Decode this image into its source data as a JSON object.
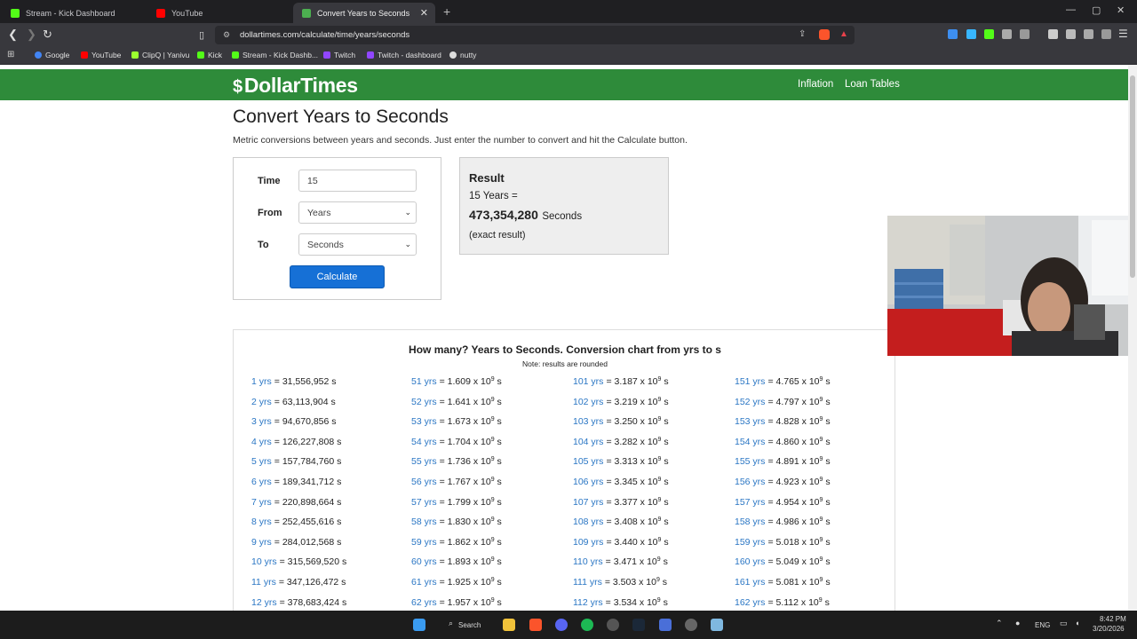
{
  "browser": {
    "tabs": [
      {
        "label": "Stream - Kick Dashboard",
        "color": "#53fc18"
      },
      {
        "label": "YouTube",
        "color": "#ff0000"
      },
      {
        "label": "Convert Years to Seconds",
        "color": "#4caf50"
      }
    ],
    "url": "dollartimes.com/calculate/time/years/seconds",
    "bookmarks": [
      "Google",
      "YouTube",
      "ClipQ | Yanivu",
      "Kick",
      "Stream - Kick Dashb...",
      "Twitch",
      "Twitch - dashboard",
      "nutty"
    ]
  },
  "site": {
    "logo_symbol": "$",
    "logo_text": "DollarTimes",
    "nav": [
      "Inflation",
      "Loan Tables"
    ],
    "brand_color": "#2e8b3a"
  },
  "page": {
    "title": "Convert Years to Seconds",
    "subtitle": "Metric conversions between years and seconds. Just enter the number to convert and hit the Calculate button."
  },
  "form": {
    "time_label": "Time",
    "time_value": "15",
    "from_label": "From",
    "from_value": "Years",
    "to_label": "To",
    "to_value": "Seconds",
    "calculate_label": "Calculate"
  },
  "result": {
    "title": "Result",
    "line1": "15 Years =",
    "value": "473,354,280",
    "unit": "Seconds",
    "note": "(exact result)"
  },
  "chart": {
    "title": "How many? Years to Seconds. Conversion chart from yrs to s",
    "note": "Note: results are rounded",
    "columns": [
      [
        {
          "years": "1 yrs",
          "value": "= 31,556,952 s"
        },
        {
          "years": "2 yrs",
          "value": "= 63,113,904 s"
        },
        {
          "years": "3 yrs",
          "value": "= 94,670,856 s"
        },
        {
          "years": "4 yrs",
          "value": "= 126,227,808 s"
        },
        {
          "years": "5 yrs",
          "value": "= 157,784,760 s"
        },
        {
          "years": "6 yrs",
          "value": "= 189,341,712 s"
        },
        {
          "years": "7 yrs",
          "value": "= 220,898,664 s"
        },
        {
          "years": "8 yrs",
          "value": "= 252,455,616 s"
        },
        {
          "years": "9 yrs",
          "value": "= 284,012,568 s"
        },
        {
          "years": "10 yrs",
          "value": "= 315,569,520 s"
        },
        {
          "years": "11 yrs",
          "value": "= 347,126,472 s"
        },
        {
          "years": "12 yrs",
          "value": "= 378,683,424 s"
        }
      ],
      [
        {
          "years": "51 yrs",
          "value": "= 1.609 x 10",
          "exp": "9",
          "unit": " s"
        },
        {
          "years": "52 yrs",
          "value": "= 1.641 x 10",
          "exp": "9",
          "unit": " s"
        },
        {
          "years": "53 yrs",
          "value": "= 1.673 x 10",
          "exp": "9",
          "unit": " s"
        },
        {
          "years": "54 yrs",
          "value": "= 1.704 x 10",
          "exp": "9",
          "unit": " s"
        },
        {
          "years": "55 yrs",
          "value": "= 1.736 x 10",
          "exp": "9",
          "unit": " s"
        },
        {
          "years": "56 yrs",
          "value": "= 1.767 x 10",
          "exp": "9",
          "unit": " s"
        },
        {
          "years": "57 yrs",
          "value": "= 1.799 x 10",
          "exp": "9",
          "unit": " s"
        },
        {
          "years": "58 yrs",
          "value": "= 1.830 x 10",
          "exp": "9",
          "unit": " s"
        },
        {
          "years": "59 yrs",
          "value": "= 1.862 x 10",
          "exp": "9",
          "unit": " s"
        },
        {
          "years": "60 yrs",
          "value": "= 1.893 x 10",
          "exp": "9",
          "unit": " s"
        },
        {
          "years": "61 yrs",
          "value": "= 1.925 x 10",
          "exp": "9",
          "unit": " s"
        },
        {
          "years": "62 yrs",
          "value": "= 1.957 x 10",
          "exp": "9",
          "unit": " s"
        }
      ],
      [
        {
          "years": "101 yrs",
          "value": "= 3.187 x 10",
          "exp": "9",
          "unit": " s"
        },
        {
          "years": "102 yrs",
          "value": "= 3.219 x 10",
          "exp": "9",
          "unit": " s"
        },
        {
          "years": "103 yrs",
          "value": "= 3.250 x 10",
          "exp": "9",
          "unit": " s"
        },
        {
          "years": "104 yrs",
          "value": "= 3.282 x 10",
          "exp": "9",
          "unit": " s"
        },
        {
          "years": "105 yrs",
          "value": "= 3.313 x 10",
          "exp": "9",
          "unit": " s"
        },
        {
          "years": "106 yrs",
          "value": "= 3.345 x 10",
          "exp": "9",
          "unit": " s"
        },
        {
          "years": "107 yrs",
          "value": "= 3.377 x 10",
          "exp": "9",
          "unit": " s"
        },
        {
          "years": "108 yrs",
          "value": "= 3.408 x 10",
          "exp": "9",
          "unit": " s"
        },
        {
          "years": "109 yrs",
          "value": "= 3.440 x 10",
          "exp": "9",
          "unit": " s"
        },
        {
          "years": "110 yrs",
          "value": "= 3.471 x 10",
          "exp": "9",
          "unit": " s"
        },
        {
          "years": "111 yrs",
          "value": "= 3.503 x 10",
          "exp": "9",
          "unit": " s"
        },
        {
          "years": "112 yrs",
          "value": "= 3.534 x 10",
          "exp": "9",
          "unit": " s"
        }
      ],
      [
        {
          "years": "151 yrs",
          "value": "= 4.765 x 10",
          "exp": "9",
          "unit": " s"
        },
        {
          "years": "152 yrs",
          "value": "= 4.797 x 10",
          "exp": "9",
          "unit": " s"
        },
        {
          "years": "153 yrs",
          "value": "= 4.828 x 10",
          "exp": "9",
          "unit": " s"
        },
        {
          "years": "154 yrs",
          "value": "= 4.860 x 10",
          "exp": "9",
          "unit": " s"
        },
        {
          "years": "155 yrs",
          "value": "= 4.891 x 10",
          "exp": "9",
          "unit": " s"
        },
        {
          "years": "156 yrs",
          "value": "= 4.923 x 10",
          "exp": "9",
          "unit": " s"
        },
        {
          "years": "157 yrs",
          "value": "= 4.954 x 10",
          "exp": "9",
          "unit": " s"
        },
        {
          "years": "158 yrs",
          "value": "= 4.986 x 10",
          "exp": "9",
          "unit": " s"
        },
        {
          "years": "159 yrs",
          "value": "= 5.018 x 10",
          "exp": "9",
          "unit": " s"
        },
        {
          "years": "160 yrs",
          "value": "= 5.049 x 10",
          "exp": "9",
          "unit": " s"
        },
        {
          "years": "161 yrs",
          "value": "= 5.081 x 10",
          "exp": "9",
          "unit": " s"
        },
        {
          "years": "162 yrs",
          "value": "= 5.112 x 10",
          "exp": "9",
          "unit": " s"
        }
      ]
    ]
  },
  "taskbar": {
    "search_label": "Search",
    "lang": "ENG",
    "time": "8:42 PM",
    "date": "3/20/2026"
  }
}
